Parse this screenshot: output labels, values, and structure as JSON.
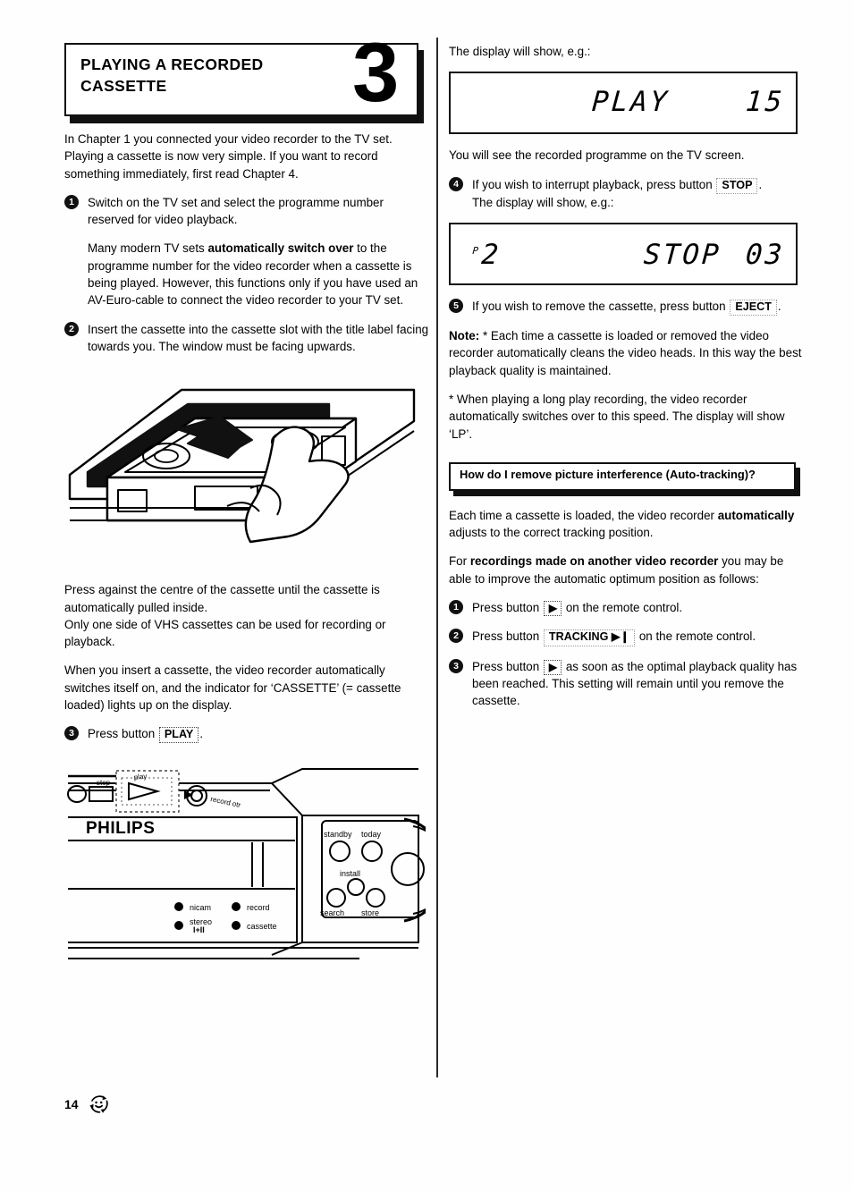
{
  "page": {
    "number": "14",
    "footer_icon": "recycle-smiley-icon"
  },
  "chapter": {
    "number": "3",
    "title": "PLAYING A RECORDED\nCASSETTE"
  },
  "left_column": {
    "intro": "In Chapter 1 you connected your video recorder to the TV set. Playing a cassette is now very simple. If you want to record something immediately, first read Chapter 4.",
    "step1": {
      "num": "1",
      "text": "Switch on the TV set and select the programme number reserved for video playback."
    },
    "step1_note_a": "Many modern TV sets ",
    "step1_note_bold": "automatically switch over",
    "step1_note_b": " to the programme number for the video recorder when a cassette is being played. However, this functions only if you have used an AV-Euro-cable to connect the video recorder to your TV set.",
    "step2": {
      "num": "2",
      "text": "Insert the cassette into the cassette slot with the title label facing towards you. The window must be facing upwards."
    },
    "figure_cassette": "cassette-insertion-illustration",
    "para_press": "Press against the centre of the cassette until the cassette is automatically pulled inside.\nOnly one side of VHS cassettes can be used for recording or playback.",
    "para_insert": "When you insert a cassette, the video recorder automatically switches itself on, and the indicator for ‘CASSETTE’ (= cassette loaded) lights up on the display.",
    "step3": {
      "num": "3",
      "pre": "Press button ",
      "key": "PLAY",
      "post": "."
    },
    "figure_vcr": "vcr-front-panel-illustration"
  },
  "vcr_panel": {
    "brand": "PHILIPS",
    "button_stop": "stop",
    "button_play": "play",
    "label_record_otr": "record otr",
    "indicators": [
      "nicam",
      "record",
      "stereo\nI+II",
      "cassette"
    ],
    "right_buttons": [
      "standby",
      "today",
      "install",
      "search",
      "store"
    ]
  },
  "right_column": {
    "display_intro": "The display will show, e.g.:",
    "lcd_play": {
      "word": "PLAY",
      "counter": "15"
    },
    "after_play": "You will see the recorded programme on the TV screen.",
    "step4": {
      "num": "4",
      "pre": "If you wish to interrupt playback, press button ",
      "key": "STOP",
      "post": ".",
      "line2": "The display will show, e.g.:"
    },
    "lcd_stop": {
      "prog_label": "P",
      "prog": "2",
      "word": "STOP",
      "counter": "03"
    },
    "step5": {
      "num": "5",
      "pre": "If you wish to remove the cassette, press button ",
      "key": "EJECT",
      "post": "."
    },
    "note_label": "Note:",
    "note_a": " * Each time a cassette is loaded or removed the video recorder automatically cleans the video heads. In this way the best playback quality is maintained.",
    "note_b": "* When playing a long play recording, the video recorder automatically switches over to this speed. The display will show ‘LP’.",
    "question_banner": "How do I remove picture interference (Auto-tracking)?",
    "tracking_intro_a": "Each time a cassette is loaded, the video recorder ",
    "tracking_intro_bold": "automatically",
    "tracking_intro_b": " adjusts to the correct tracking position.",
    "tracking_para_a": "For ",
    "tracking_para_bold": "recordings made on another video recorder",
    "tracking_para_b": " you may be able to improve the automatic optimum position as follows:",
    "t_step1": {
      "num": "1",
      "pre": "Press button ",
      "key": "▶",
      "post": " on the remote control."
    },
    "t_step2": {
      "num": "2",
      "pre": "Press button ",
      "key": "TRACKING ▶❙",
      "post": " on the remote control."
    },
    "t_step3": {
      "num": "3",
      "pre": "Press button ",
      "key": "▶",
      "post": " as soon as the optimal playback quality has been reached. This setting will remain until you remove the cassette."
    }
  }
}
